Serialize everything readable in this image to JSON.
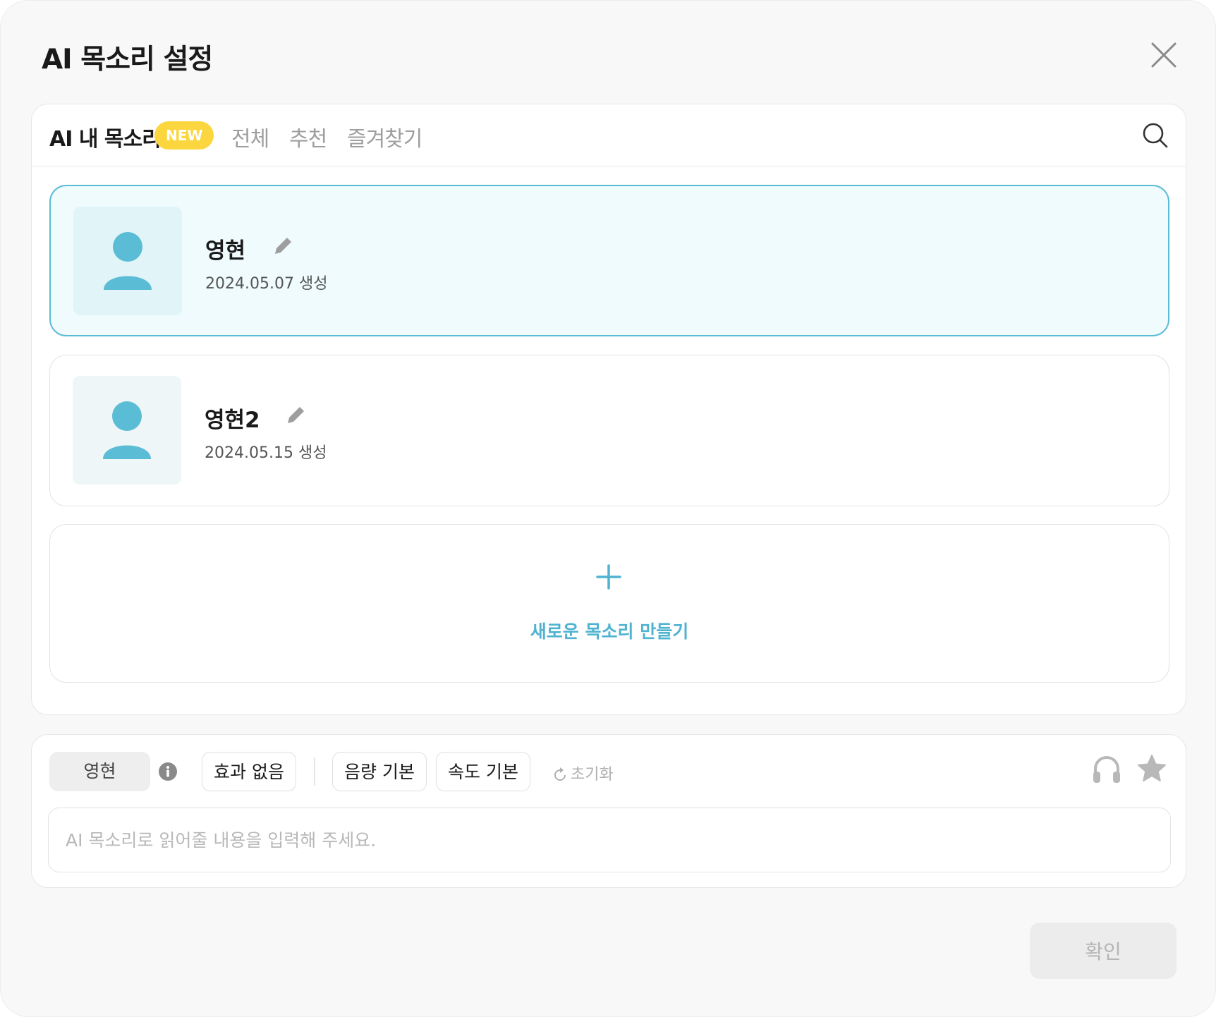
{
  "dialog": {
    "title": "AI 목소리 설정"
  },
  "tabs": [
    {
      "label": "AI 내 목소리",
      "active": true,
      "badge": "NEW"
    },
    {
      "label": "전체",
      "active": false
    },
    {
      "label": "추천",
      "active": false
    },
    {
      "label": "즐겨찾기",
      "active": false
    }
  ],
  "voices": [
    {
      "name": "영현",
      "date": "2024.05.07 생성",
      "selected": true
    },
    {
      "name": "영현2",
      "date": "2024.05.15 생성",
      "selected": false
    }
  ],
  "create_voice_label": "새로운 목소리 만들기",
  "controls": {
    "selected_voice": "영현",
    "effect": "효과 없음",
    "volume": "음량 기본",
    "speed": "속도 기본",
    "reset": "초기화"
  },
  "input": {
    "placeholder": "AI 목소리로 읽어줄 내용을 입력해 주세요.",
    "value": ""
  },
  "confirm_label": "확인",
  "colors": {
    "accent": "#4fb3d0",
    "badge": "#fbd63f",
    "selected_bg": "#effbfd"
  }
}
